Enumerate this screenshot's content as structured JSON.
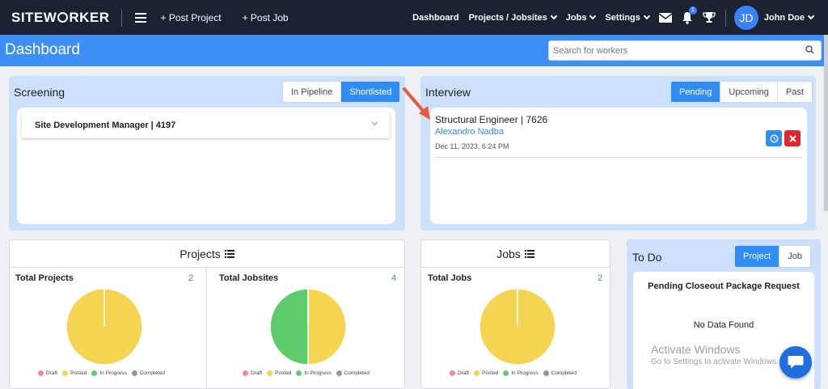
{
  "nav": {
    "logo": "SITEWORKER",
    "post_project": "+ Post Project",
    "post_job": "+ Post Job",
    "menu": [
      {
        "label": "Dashboard",
        "dropdown": false
      },
      {
        "label": "Projects / Jobsites",
        "dropdown": true
      },
      {
        "label": "Jobs",
        "dropdown": true
      },
      {
        "label": "Settings",
        "dropdown": true
      }
    ],
    "notifications_count": "1",
    "user": {
      "initials": "JD",
      "name": "John Doe"
    }
  },
  "header": {
    "title": "Dashboard",
    "search_placeholder": "Search for workers"
  },
  "screening": {
    "title": "Screening",
    "tabs": [
      {
        "label": "In Pipeline",
        "active": false
      },
      {
        "label": "Shortlisted",
        "active": true
      }
    ],
    "item": "Site Development Manager | 4197"
  },
  "interview": {
    "title": "Interview",
    "tabs": [
      {
        "label": "Pending",
        "active": true
      },
      {
        "label": "Upcoming",
        "active": false
      },
      {
        "label": "Past",
        "active": false
      }
    ],
    "entry": {
      "title": "Structural Engineer | 7626",
      "name": "Alexandro Nadba",
      "date": "Dec 11, 2023, 6:24 PM"
    }
  },
  "projects": {
    "title": "Projects",
    "total_projects_label": "Total Projects",
    "total_projects": "2",
    "total_jobsites_label": "Total Jobsites",
    "total_jobsites": "4"
  },
  "jobs": {
    "title": "Jobs",
    "total_jobs_label": "Total Jobs",
    "total_jobs": "2"
  },
  "legend": [
    {
      "label": "Draft",
      "color": "#f28b8b"
    },
    {
      "label": "Posted",
      "color": "#f5d451"
    },
    {
      "label": "In Progress",
      "color": "#5dcc6a"
    },
    {
      "label": "Completed",
      "color": "#8c97a6"
    }
  ],
  "chart_data": [
    {
      "type": "pie",
      "title": "Total Projects",
      "categories": [
        "Draft",
        "Posted",
        "In Progress",
        "Completed"
      ],
      "values": [
        0,
        2,
        0,
        0
      ]
    },
    {
      "type": "pie",
      "title": "Total Jobsites",
      "categories": [
        "Draft",
        "Posted",
        "In Progress",
        "Completed"
      ],
      "values": [
        0,
        2,
        2,
        0
      ]
    },
    {
      "type": "pie",
      "title": "Total Jobs",
      "categories": [
        "Draft",
        "Posted",
        "In Progress",
        "Completed"
      ],
      "values": [
        0,
        2,
        0,
        0
      ]
    }
  ],
  "todo": {
    "title": "To Do",
    "tabs": [
      {
        "label": "Project",
        "active": true
      },
      {
        "label": "Job",
        "active": false
      }
    ],
    "section_title": "Pending Closeout Package Request",
    "empty": "No Data Found"
  },
  "watermark": {
    "line1": "Activate Windows",
    "line2": "Go to Settings to activate Windows."
  },
  "colors": {
    "nav_bg": "#1b2333",
    "accent": "#3d8ef5",
    "panel_bg": "#cde0fb",
    "danger": "#e0262d",
    "arrow": "#e8573f"
  },
  "icons": [
    "menu-icon",
    "mail-icon",
    "bell-icon",
    "trophy-icon",
    "search-icon",
    "list-icon",
    "clock-icon",
    "close-icon",
    "chat-icon",
    "chevron-down-icon"
  ]
}
